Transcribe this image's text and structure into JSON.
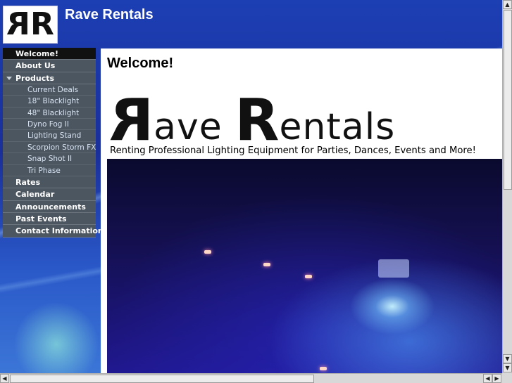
{
  "site": {
    "logo_letters": "RR",
    "title": "Rave Rentals"
  },
  "nav": {
    "items": [
      {
        "label": "Welcome!",
        "active": true
      },
      {
        "label": "About Us"
      },
      {
        "label": "Products",
        "expanded": true,
        "children": [
          "Current Deals",
          "18\" Blacklight",
          "48\" Blacklight",
          "Dyno Fog II",
          "Lighting Stand",
          "Scorpion Storm FX",
          "Snap Shot II",
          "Tri Phase"
        ]
      },
      {
        "label": "Rates"
      },
      {
        "label": "Calendar"
      },
      {
        "label": "Announcements"
      },
      {
        "label": "Past Events"
      },
      {
        "label": "Contact Information"
      }
    ]
  },
  "main": {
    "heading": "Welcome!",
    "brand_first": "R",
    "brand_word1": "ave ",
    "brand_second": "R",
    "brand_word2": "entals",
    "tagline": "Renting Professional Lighting Equipment for Parties, Dances, Events and More!"
  },
  "scrollbars": {
    "up": "▲",
    "down": "▼",
    "left": "◀",
    "right": "▶"
  },
  "colors": {
    "nav_bg": "#4c5660",
    "nav_active": "#111111",
    "header_text": "#ffffff"
  }
}
